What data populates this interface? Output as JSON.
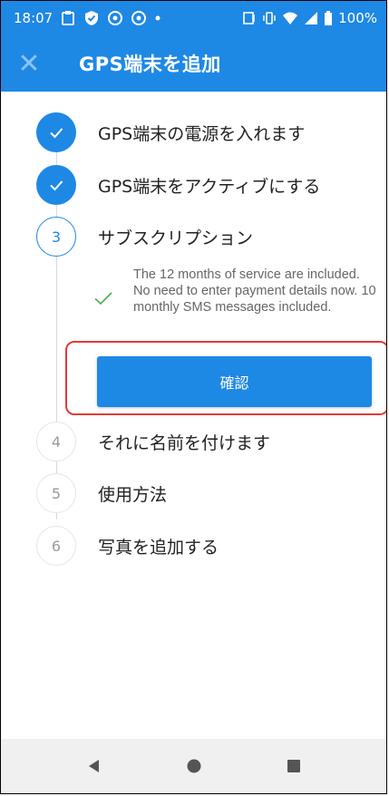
{
  "status_bar": {
    "time": "18:07",
    "battery": "100%"
  },
  "app_bar": {
    "close_icon": "close-icon",
    "title": "GPS端末を追加"
  },
  "steps": [
    {
      "number": "1",
      "label": "GPS端末の電源を入れます",
      "state": "done"
    },
    {
      "number": "2",
      "label": "GPS端末をアクティブにする",
      "state": "done"
    },
    {
      "number": "3",
      "label": "サブスクリプション",
      "state": "active"
    },
    {
      "number": "4",
      "label": "それに名前を付けます",
      "state": "pending"
    },
    {
      "number": "5",
      "label": "使用方法",
      "state": "pending"
    },
    {
      "number": "6",
      "label": "写真を追加する",
      "state": "pending"
    }
  ],
  "subscription": {
    "included_text": "The 12 months of service are included. No need to enter payment details now. 10 monthly SMS messages included.",
    "confirm_label": "確認"
  },
  "colors": {
    "primary": "#1e88e5",
    "check_green": "#4caf50",
    "highlight_red": "#e53935"
  }
}
